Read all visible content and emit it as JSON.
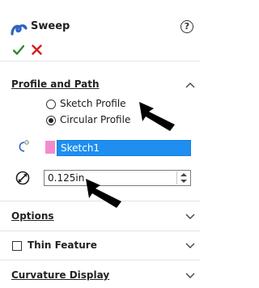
{
  "panel": {
    "title": "Sweep",
    "help_icon": "question-circle-icon",
    "feature_icon": "sweep-icon",
    "ok_icon": "checkmark-icon",
    "cancel_icon": "x-icon"
  },
  "profile_and_path": {
    "header": "Profile and Path",
    "expanded": true,
    "options": [
      {
        "label": "Sketch Profile",
        "checked": false
      },
      {
        "label": "Circular Profile",
        "checked": true
      }
    ],
    "path_field": {
      "value": "Sketch1",
      "color": "#f28ccf",
      "selected": true
    },
    "diameter_field": {
      "value": "0.125in"
    }
  },
  "sections": [
    {
      "header": "Options",
      "expanded": false
    },
    {
      "header": "Thin Feature",
      "expanded": false,
      "checkbox": true,
      "checked": false
    },
    {
      "header": "Curvature Display",
      "expanded": false
    }
  ],
  "colors": {
    "accent": "#1e8ff0",
    "ok": "#2c8c2c",
    "cancel": "#d81b1b",
    "swatch": "#f28ccf"
  }
}
